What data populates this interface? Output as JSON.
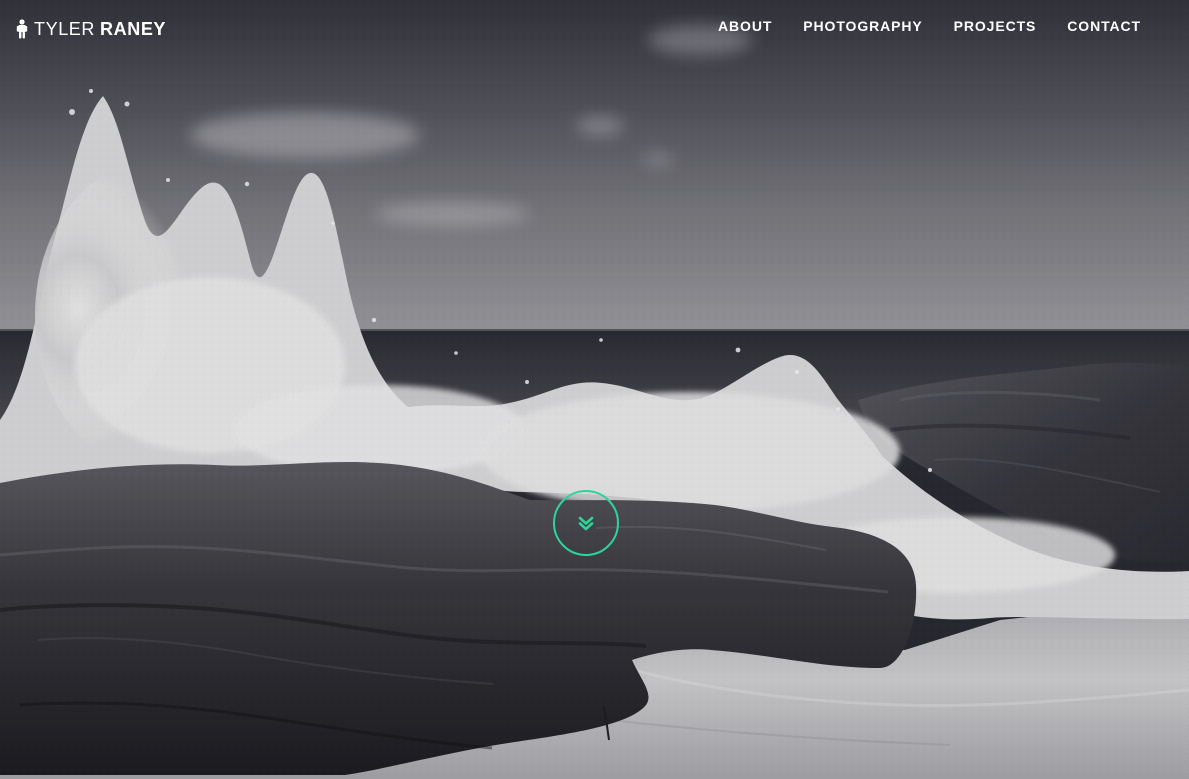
{
  "header": {
    "brand": {
      "first_name": "TYLER",
      "last_name": "RANEY",
      "icon": "person-icon"
    },
    "nav": [
      {
        "label": "ABOUT"
      },
      {
        "label": "PHOTOGRAPHY"
      },
      {
        "label": "PROJECTS"
      },
      {
        "label": "CONTACT"
      }
    ]
  },
  "hero": {
    "background": "black-and-white-ocean-waves-crashing-on-rocks",
    "scroll_button_icon": "double-chevron-down-icon",
    "accent_color": "#2fd49b"
  }
}
